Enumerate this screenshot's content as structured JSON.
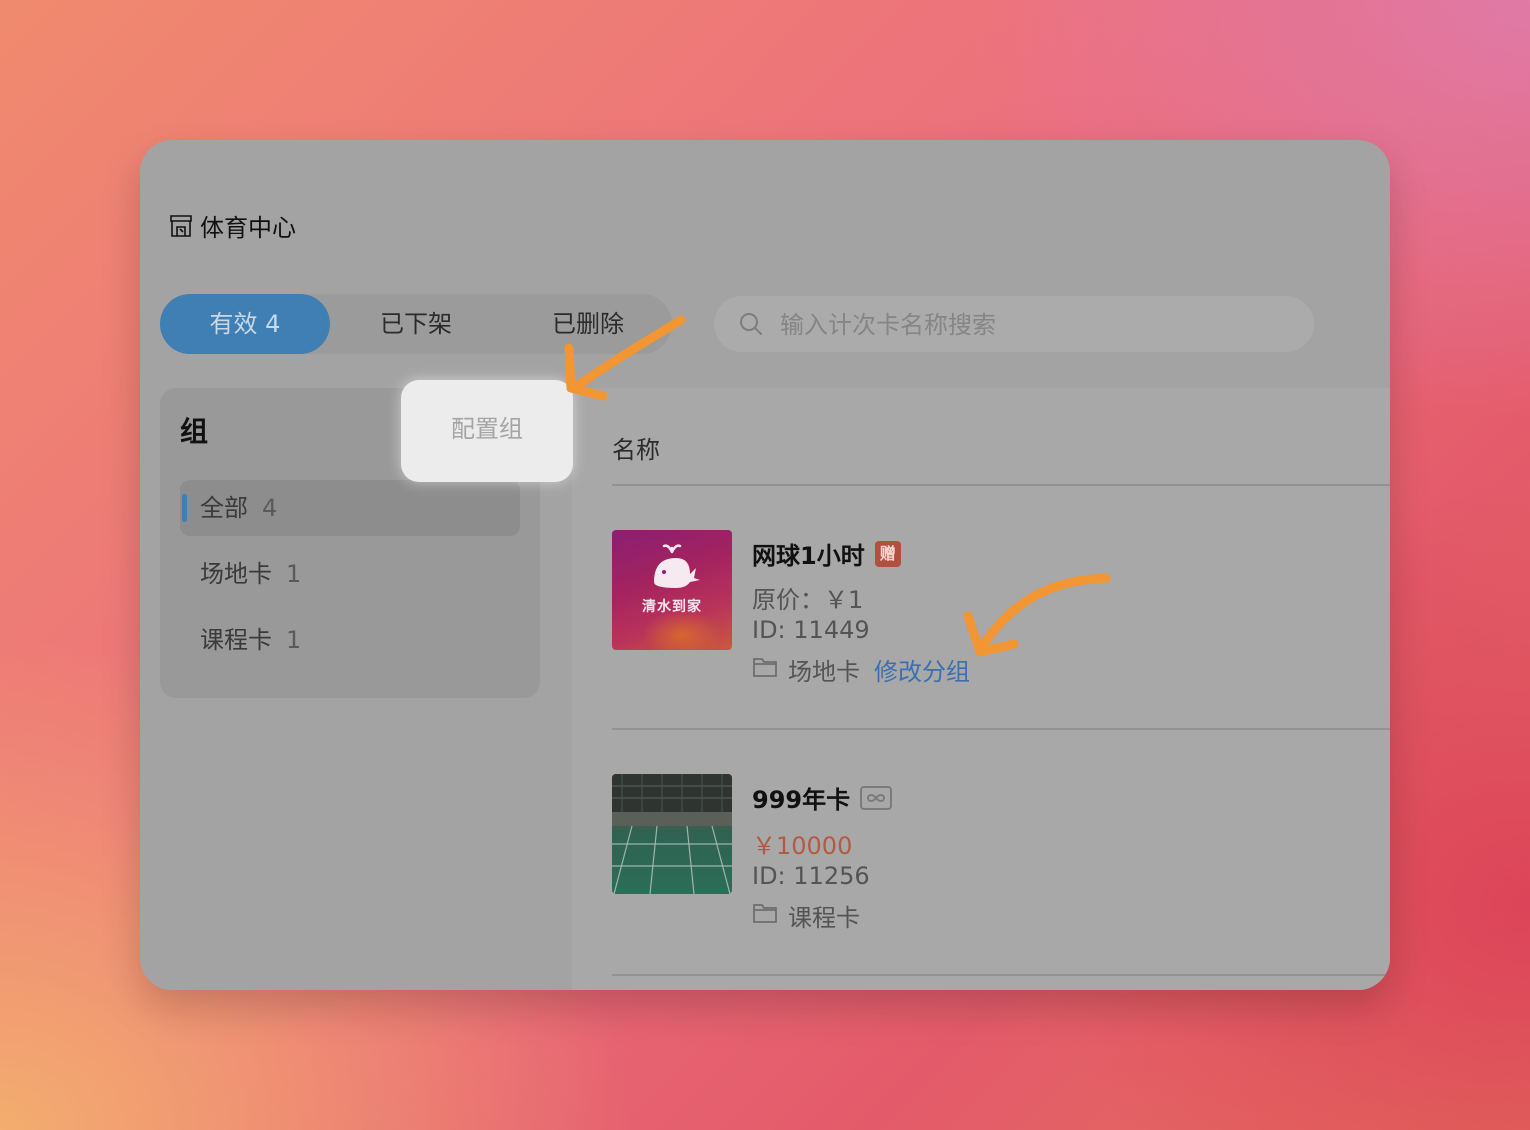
{
  "venue": {
    "name": "体育中心",
    "icon": "store-icon"
  },
  "tabs": [
    {
      "label": "有效 4",
      "active": true
    },
    {
      "label": "已下架",
      "active": false
    },
    {
      "label": "已删除",
      "active": false
    }
  ],
  "search": {
    "placeholder": "输入计次卡名称搜索",
    "value": "",
    "icon": "search-icon"
  },
  "sidebar": {
    "title": "组",
    "config_button": "配置组",
    "groups": [
      {
        "name": "全部",
        "count": "4",
        "active": true
      },
      {
        "name": "场地卡",
        "count": "1",
        "active": false
      },
      {
        "name": "课程卡",
        "count": "1",
        "active": false
      }
    ]
  },
  "table": {
    "column_name": "名称",
    "products": [
      {
        "name": "网球1小时",
        "badge": "赠",
        "price": "原价：￥1",
        "id": "ID: 11449",
        "group": "场地卡",
        "edit_link": "修改分组",
        "thumbnail_text": "清水到家"
      },
      {
        "name": "999年卡",
        "badge_icon": "infinity-icon",
        "price": "￥10000",
        "id": "ID: 11256",
        "group": "课程卡"
      }
    ]
  },
  "colors": {
    "accent": "#3f7fb3",
    "link": "#3d6fb0",
    "price_highlight": "#b35a42",
    "gift_badge": "#b2503f",
    "annotation_arrow": "#f29533"
  }
}
